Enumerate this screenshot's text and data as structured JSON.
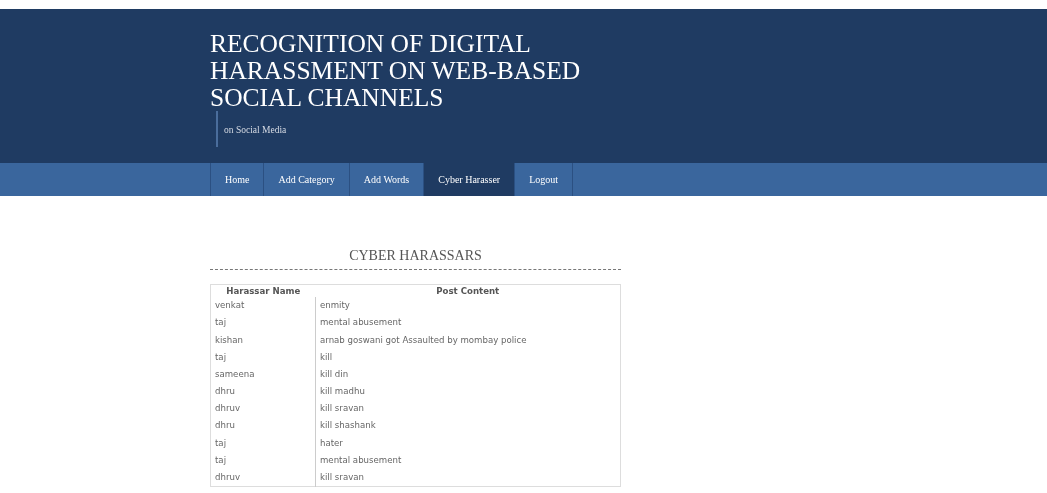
{
  "header": {
    "title": "RECOGNITION OF DIGITAL HARASSMENT ON WEB-BASED SOCIAL CHANNELS",
    "tagline": "on Social Media"
  },
  "nav": [
    {
      "label": "Home",
      "selected": false
    },
    {
      "label": "Add Category",
      "selected": false
    },
    {
      "label": "Add Words",
      "selected": false
    },
    {
      "label": "Cyber Harasser",
      "selected": true
    },
    {
      "label": "Logout",
      "selected": false
    }
  ],
  "section_title": "CYBER HARASSARS",
  "table": {
    "columns": [
      "Harassar Name",
      "Post Content"
    ],
    "rows": [
      [
        "venkat",
        "enmity"
      ],
      [
        "taj",
        "mental abusement"
      ],
      [
        "kishan",
        "arnab goswani got Assaulted by mombay police"
      ],
      [
        "taj",
        "kill"
      ],
      [
        "sameena",
        "kill din"
      ],
      [
        "dhru",
        "kill madhu"
      ],
      [
        "dhruv",
        "kill sravan"
      ],
      [
        "dhru",
        "kill shashank"
      ],
      [
        "taj",
        "hater"
      ],
      [
        "taj",
        "mental abusement"
      ],
      [
        "dhruv",
        "kill sravan"
      ]
    ]
  }
}
